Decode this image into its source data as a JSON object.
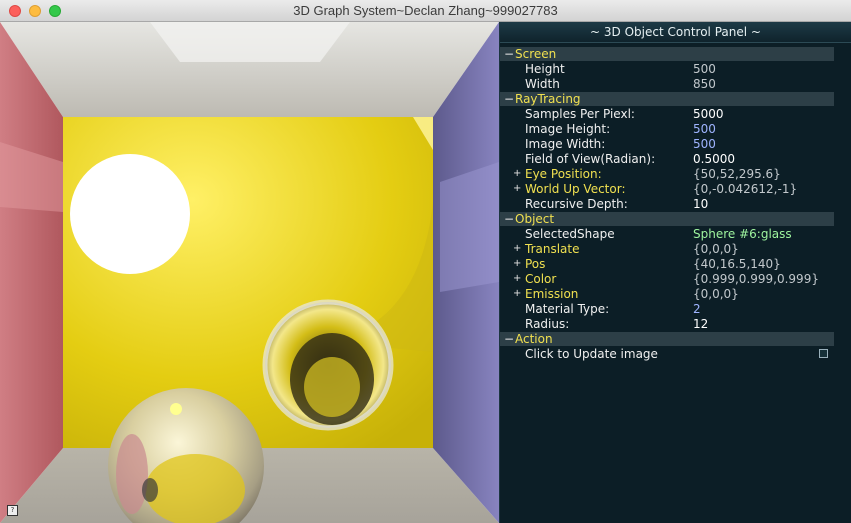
{
  "window": {
    "title": "3D Graph System~Declan Zhang~999027783"
  },
  "panel": {
    "title": "~ 3D Object Control Panel ~",
    "groups": [
      {
        "label": "Screen",
        "rows": [
          {
            "label": "Height",
            "value": "500",
            "label_color": "white",
            "value_color": "gray"
          },
          {
            "label": "Width",
            "value": "850",
            "label_color": "white",
            "value_color": "gray"
          }
        ]
      },
      {
        "label": "RayTracing",
        "rows": [
          {
            "label": "Samples Per Piexl:",
            "value": "5000",
            "label_color": "white",
            "value_color": "white"
          },
          {
            "label": "Image Height:",
            "value": "500",
            "label_color": "white",
            "value_color": "blue"
          },
          {
            "label": "Image Width:",
            "value": "500",
            "label_color": "white",
            "value_color": "blue"
          },
          {
            "label": "Field of View(Radian):",
            "value": "0.5000",
            "label_color": "white",
            "value_color": "white"
          },
          {
            "label": "Eye Position:",
            "value": "{50,52,295.6}",
            "label_color": "yellow",
            "value_color": "gray",
            "expandable": true
          },
          {
            "label": "World Up Vector:",
            "value": "{0,-0.042612,-1}",
            "label_color": "yellow",
            "value_color": "gray",
            "expandable": true
          },
          {
            "label": "Recursive Depth:",
            "value": "10",
            "label_color": "white",
            "value_color": "white"
          }
        ]
      },
      {
        "label": "Object",
        "rows": [
          {
            "label": "SelectedShape",
            "value": "Sphere #6:glass",
            "label_color": "white",
            "value_color": "green"
          },
          {
            "label": "Translate",
            "value": "{0,0,0}",
            "label_color": "yellow",
            "value_color": "gray",
            "expandable": true
          },
          {
            "label": "Pos",
            "value": "{40,16.5,140}",
            "label_color": "yellow",
            "value_color": "gray",
            "expandable": true
          },
          {
            "label": "Color",
            "value": "{0.999,0.999,0.999}",
            "label_color": "yellow",
            "value_color": "gray",
            "expandable": true
          },
          {
            "label": "Emission",
            "value": "{0,0,0}",
            "label_color": "yellow",
            "value_color": "gray",
            "expandable": true
          },
          {
            "label": "Material Type:",
            "value": "2",
            "label_color": "white",
            "value_color": "blue"
          },
          {
            "label": "Radius:",
            "value": "12",
            "label_color": "white",
            "value_color": "white"
          }
        ]
      },
      {
        "label": "Action",
        "rows": [
          {
            "label": "Click to Update image",
            "value": "",
            "label_color": "white",
            "value_color": "white",
            "checkbox": true,
            "checked": false
          }
        ]
      }
    ]
  },
  "colors": {
    "accent_yellow": "#f0e050",
    "panel_bg": "#0c1e26",
    "group_bg": "#2d3f47"
  }
}
